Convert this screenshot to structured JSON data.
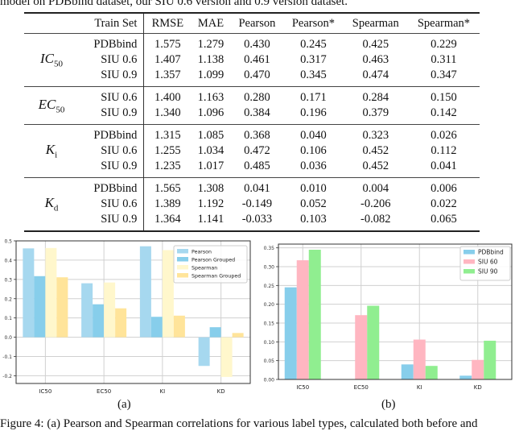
{
  "caption_top": "model on PDBbind dataset, our SIU 0.6 version and 0.9 version dataset.",
  "table": {
    "headers": [
      "Train Set",
      "RMSE",
      "MAE",
      "Pearson",
      "Pearson*",
      "Spearman",
      "Spearman*"
    ],
    "groups": [
      {
        "label": "IC",
        "sub": "50",
        "rows": [
          [
            "PDBbind",
            "1.575",
            "1.279",
            "0.430",
            "0.245",
            "0.425",
            "0.229"
          ],
          [
            "SIU 0.6",
            "1.407",
            "1.138",
            "0.461",
            "0.317",
            "0.463",
            "0.311"
          ],
          [
            "SIU 0.9",
            "1.357",
            "1.099",
            "0.470",
            "0.345",
            "0.474",
            "0.347"
          ]
        ]
      },
      {
        "label": "EC",
        "sub": "50",
        "rows": [
          [
            "SIU 0.6",
            "1.400",
            "1.163",
            "0.280",
            "0.171",
            "0.284",
            "0.150"
          ],
          [
            "SIU 0.9",
            "1.340",
            "1.096",
            "0.384",
            "0.196",
            "0.379",
            "0.142"
          ]
        ]
      },
      {
        "label": "K",
        "sub": "i",
        "rows": [
          [
            "PDBbind",
            "1.315",
            "1.085",
            "0.368",
            "0.040",
            "0.323",
            "0.026"
          ],
          [
            "SIU 0.6",
            "1.255",
            "1.034",
            "0.472",
            "0.106",
            "0.452",
            "0.112"
          ],
          [
            "SIU 0.9",
            "1.235",
            "1.017",
            "0.485",
            "0.036",
            "0.452",
            "0.041"
          ]
        ]
      },
      {
        "label": "K",
        "sub": "d",
        "rows": [
          [
            "PDBbind",
            "1.565",
            "1.308",
            "0.041",
            "0.010",
            "0.004",
            "0.006"
          ],
          [
            "SIU 0.6",
            "1.389",
            "1.192",
            "-0.149",
            "0.052",
            "-0.206",
            "0.022"
          ],
          [
            "SIU 0.9",
            "1.364",
            "1.141",
            "-0.033",
            "0.103",
            "-0.082",
            "0.065"
          ]
        ]
      }
    ]
  },
  "subcaptions": {
    "a": "(a)",
    "b": "(b)"
  },
  "figure_caption": "Figure 4: (a) Pearson and Spearman correlations for various label types, calculated both before and",
  "chart_data": [
    {
      "type": "bar",
      "categories": [
        "IC50",
        "EC50",
        "KI",
        "KD"
      ],
      "series": [
        {
          "name": "Pearson",
          "color": "#a6d8ef",
          "values": [
            0.461,
            0.28,
            0.472,
            -0.149
          ]
        },
        {
          "name": "Pearson Grouped",
          "color": "#87ceeb",
          "values": [
            0.317,
            0.171,
            0.106,
            0.052
          ]
        },
        {
          "name": "Spearman",
          "color": "#fff7cc",
          "values": [
            0.463,
            0.284,
            0.452,
            -0.206
          ]
        },
        {
          "name": "Spearman Grouped",
          "color": "#ffe49a",
          "values": [
            0.311,
            0.15,
            0.112,
            0.022
          ]
        }
      ],
      "yticks": [
        "0.5",
        "0.4",
        "0.3",
        "0.2",
        "0.1",
        "0.0",
        "-0.1",
        "-0.2"
      ],
      "ytick_values": [
        0.5,
        0.4,
        0.3,
        0.2,
        0.1,
        0.0,
        -0.1,
        -0.2
      ],
      "ylim": [
        -0.24,
        0.5
      ],
      "grid": true,
      "legend": "top-right",
      "xlabel": "",
      "ylabel": "",
      "title": ""
    },
    {
      "type": "bar",
      "categories": [
        "IC50",
        "EC50",
        "KI",
        "KD"
      ],
      "series": [
        {
          "name": "PDBbind",
          "color": "#87ceeb",
          "values": [
            0.245,
            null,
            0.04,
            0.01
          ]
        },
        {
          "name": "SIU 60",
          "color": "#ffb6c1",
          "values": [
            0.317,
            0.171,
            0.106,
            0.052
          ]
        },
        {
          "name": "SIU 90",
          "color": "#90ee90",
          "values": [
            0.345,
            0.196,
            0.036,
            0.103
          ]
        }
      ],
      "yticks": [
        "0.35",
        "0.30",
        "0.25",
        "0.20",
        "0.15",
        "0.10",
        "0.05",
        "0.00"
      ],
      "ytick_values": [
        0.35,
        0.3,
        0.25,
        0.2,
        0.15,
        0.1,
        0.05,
        0.0
      ],
      "ylim": [
        0.0,
        0.36
      ],
      "grid": true,
      "legend": "top-right",
      "xlabel": "",
      "ylabel": "",
      "title": ""
    }
  ]
}
